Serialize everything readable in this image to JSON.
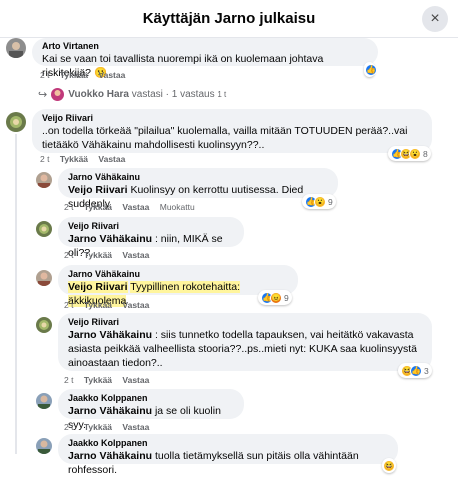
{
  "header": {
    "title": "Käyttäjän Jarno julkaisu",
    "close_label": "×"
  },
  "actions": {
    "like": "Tykkää",
    "reply": "Vastaa",
    "edited": "Muokattu"
  },
  "top_comment": {
    "author": "Arto Virtanen",
    "text": "Kai se vaan toi tavallista nuorempi ikä on kuolemaan johtava riskitekijä?",
    "time": "2 t"
  },
  "replies_link": {
    "author": "Vuokko Hara",
    "text": "vastasi · 1 vastaus",
    "time": "1 t"
  },
  "comments": [
    {
      "author": "Veijo Riivari",
      "text": "..on todella törkeää \"pilailua\" kuolemalla, vailla mitään TOTUUDEN perää?..vai tietääkö Vähäkainu mahdollisesti kuolinsyyn??..",
      "time": "2 t",
      "reactions": "8"
    },
    {
      "author": "Jarno Vähäkainu",
      "tag": "Veijo Riivari",
      "text": "Kuolinsyy on kerrottu uutisessa. Died suddenly",
      "time": "2 t",
      "reactions": "9"
    },
    {
      "author": "Veijo Riivari",
      "tag": "Jarno Vähäkainu",
      "text": ": niin, MIKÄ se oli??..",
      "time": "2 t"
    },
    {
      "author": "Jarno Vähäkainu",
      "tag": "Veijo Riivari",
      "text": "Tyypillinen rokotehaitta: äkkikuolema",
      "time": "2 t",
      "reactions": "9"
    },
    {
      "author": "Veijo Riivari",
      "tag": "Jarno Vähäkainu",
      "text": ": siis tunnetko todella tapauksen, vai heitätkö vakavasta asiasta peikkää valheellista stooria??..ps..mieti nyt: KUKA saa kuolinsyystä ainoastaan tiedon?..",
      "time": "2 t",
      "reactions": "3"
    },
    {
      "author": "Jaakko Kolppanen",
      "tag": "Jarno Vähäkainu",
      "text": "ja se oli kuolin syy.",
      "time": "2 t"
    },
    {
      "author": "Jaakko Kolppanen",
      "tag": "Jarno Vähäkainu",
      "text": "tuolla tietämyksellä sun pitäis olla vähintään rohfessori.",
      "time": ""
    }
  ]
}
